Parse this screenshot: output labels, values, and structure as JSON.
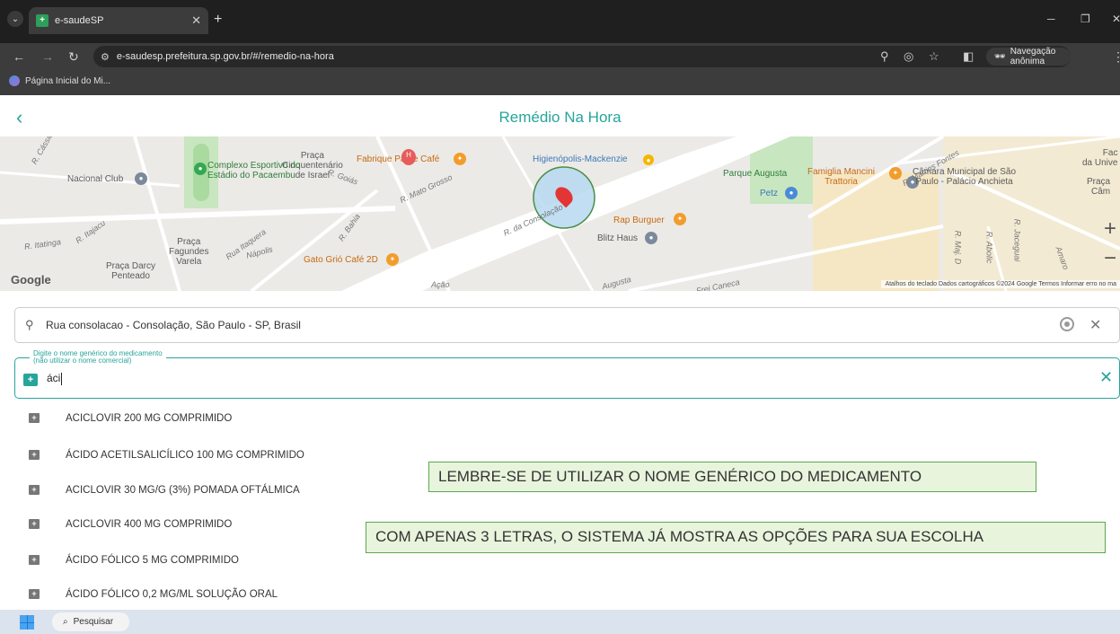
{
  "browser": {
    "tab_title": "e-saudeSP",
    "url": "e-saudesp.prefeitura.sp.gov.br/#/remedio-na-hora",
    "incognito_label": "Navegação anônima",
    "bookmark": "Página Inicial do Mi..."
  },
  "app": {
    "title": "Remédio Na Hora",
    "accent_color": "#27a59b"
  },
  "map": {
    "labels": {
      "praca_cinq": "Praça\nCinquentenário\nde Israel",
      "fabrique": "Fabrique Pão e Café",
      "higienopolis": "Higienópolis-Mackenzie",
      "complexo": "Complexo Esportivo do\nEstádio do Pacaembu",
      "nacional": "Nacional Club",
      "parque_augusta": "Parque Augusta",
      "famiglia": "Famiglia Mancini\nTrattoria",
      "camara": "Câmara Municipal de São\nPaulo - Palácio Anchieta",
      "petz": "Petz",
      "rap_burguer": "Rap Burguer",
      "blitz": "Blitz Haus",
      "gato": "Gato Grió Café 2D",
      "praca_fagundes": "Praça\nFagundes\nVarela",
      "praca_darcy": "Praça Darcy\nPenteado",
      "fac": "Fac\nda Unive",
      "praca_r": "Praça\nCâm",
      "st_itatinga": "R. Itatinga",
      "st_goias": "R. Goiás",
      "st_mato": "R. Mato Grosso",
      "st_consolacao": "R. da Consolação",
      "st_martins": "R. Martins Fontes",
      "st_caneca": "Frei Caneca",
      "st_cassio": "R. Cássio",
      "st_itaquera": "Rua Itaquera",
      "st_bahia": "R. Bahia",
      "st_napolis": "Nápolis",
      "st_itajacu": "R. Itajacu",
      "st_maj": "R. Maj. D",
      "st_abolicao": "R. Abolic",
      "st_jaceguai": "R. Jaceguai",
      "st_amaro": "Amaro",
      "st_augusta": "Augusta",
      "st_acao": "Ação"
    },
    "google": "Google",
    "attribution": "Atalhos do teclado   Dados cartográficos ©2024 Google   Termos   Informar erro no ma",
    "zoom_in": "+",
    "zoom_out": "−"
  },
  "address_field": {
    "value": "Rua consolacao - Consolação, São Paulo - SP, Brasil"
  },
  "medication_field": {
    "legend_line1": "Digite o nome genérico do medicamento",
    "legend_line2": "(não utilizar o nome comercial)",
    "value": "áci"
  },
  "suggestions": [
    "ACICLOVIR 200 MG COMPRIMIDO",
    "ÁCIDO ACETILSALICÍLICO 100 MG COMPRIMIDO",
    "ACICLOVIR 30 MG/G (3%) POMADA OFTÁLMICA",
    "ACICLOVIR 400 MG COMPRIMIDO",
    "ÁCIDO FÓLICO 5 MG COMPRIMIDO",
    "ÁCIDO FÓLICO 0,2 MG/ML SOLUÇÃO ORAL"
  ],
  "hints": {
    "hint1": "LEMBRE-SE DE UTILIZAR O NOME GENÉRICO DO MEDICAMENTO",
    "hint2": "COM APENAS 3 LETRAS, O SISTEMA JÁ MOSTRA AS OPÇÕES PARA SUA ESCOLHA"
  },
  "taskbar": {
    "search_label": "Pesquisar"
  }
}
